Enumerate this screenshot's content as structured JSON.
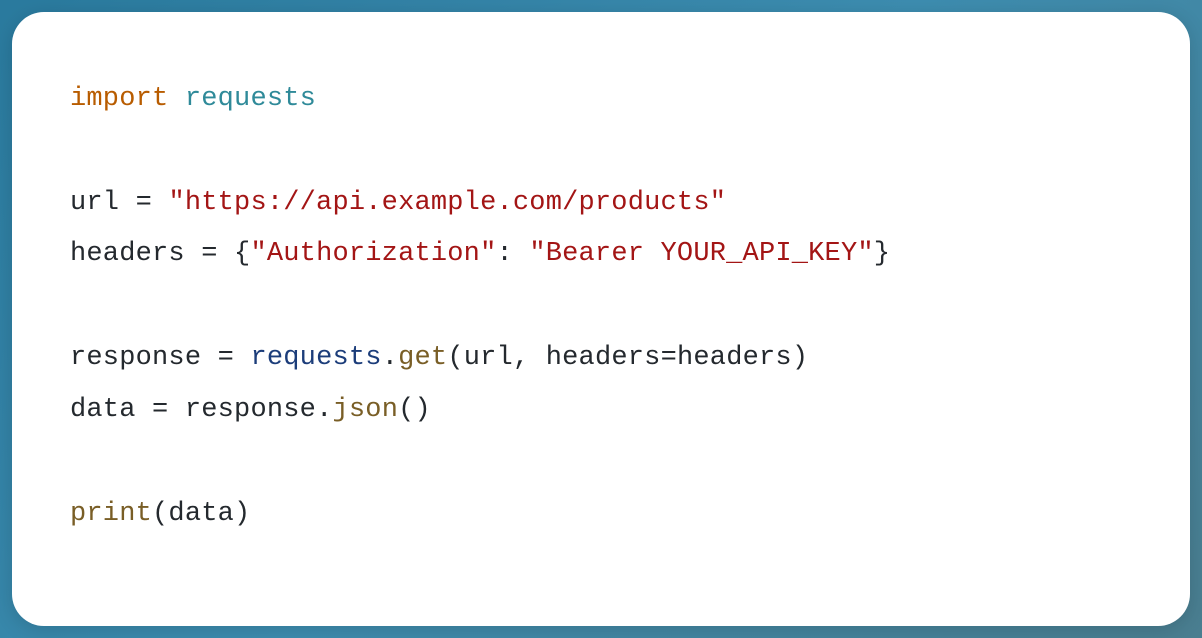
{
  "code": {
    "line1": {
      "keyword": "import",
      "module": "requests"
    },
    "line3": {
      "var": "url",
      "op": "=",
      "string": "\"https://api.example.com/products\""
    },
    "line4": {
      "var": "headers",
      "op": "=",
      "brace_open": "{",
      "key": "\"Authorization\"",
      "colon": ":",
      "value": "\"Bearer YOUR_API_KEY\"",
      "brace_close": "}"
    },
    "line6": {
      "var": "response",
      "op": "=",
      "obj": "requests",
      "dot": ".",
      "method": "get",
      "paren_open": "(",
      "arg1": "url",
      "comma": ",",
      "kwarg_name": "headers",
      "eq": "=",
      "kwarg_val": "headers",
      "paren_close": ")"
    },
    "line7": {
      "var": "data",
      "op": "=",
      "obj": "response",
      "dot": ".",
      "method": "json",
      "parens": "()"
    },
    "line9": {
      "builtin": "print",
      "paren_open": "(",
      "arg": "data",
      "paren_close": ")"
    }
  }
}
